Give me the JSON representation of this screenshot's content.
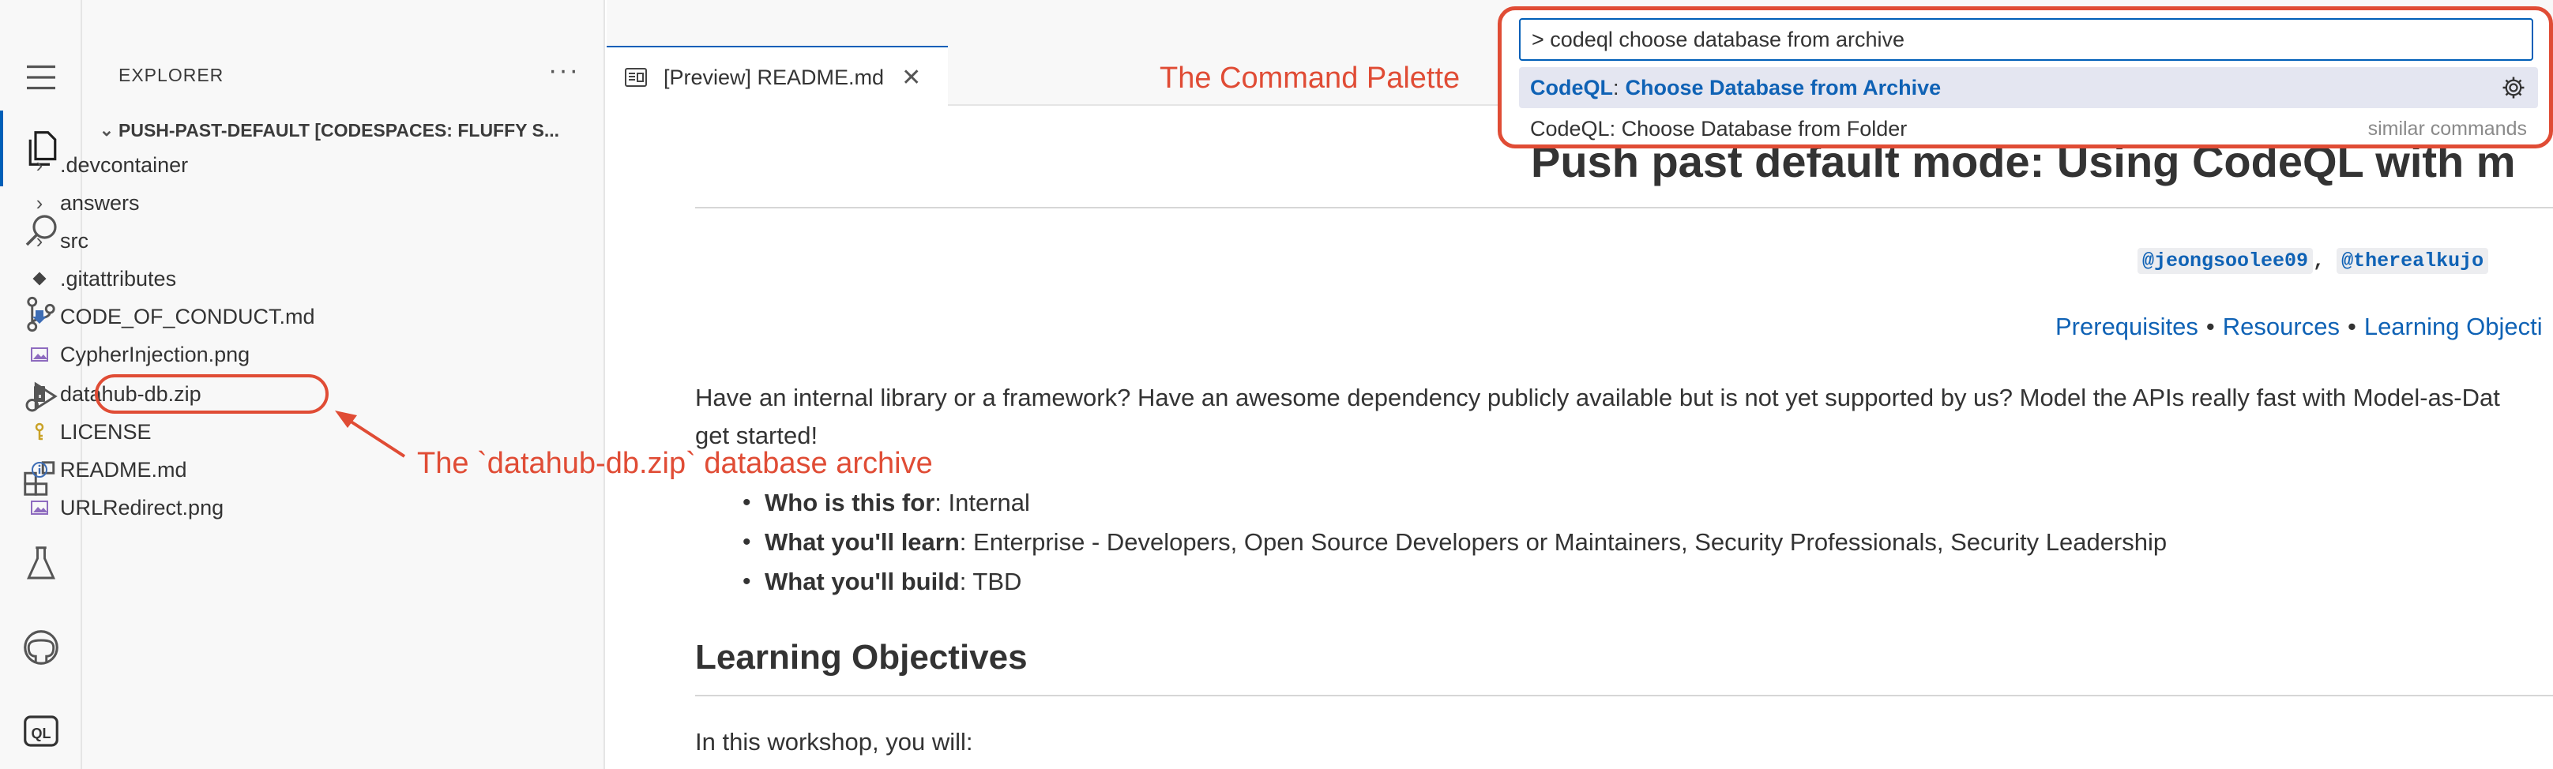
{
  "sidebar": {
    "title": "EXPLORER",
    "more": "···",
    "root_label": "PUSH-PAST-DEFAULT [CODESPACES: FLUFFY S...",
    "items": [
      {
        "label": ".devcontainer",
        "kind": "folder",
        "icon": "chevron-right-icon"
      },
      {
        "label": "answers",
        "kind": "folder",
        "icon": "chevron-right-icon"
      },
      {
        "label": "src",
        "kind": "folder",
        "icon": "chevron-right-icon"
      },
      {
        "label": ".gitattributes",
        "kind": "file",
        "icon": "git-diamond-icon"
      },
      {
        "label": "CODE_OF_CONDUCT.md",
        "kind": "file",
        "icon": "markdown-down-arrow-icon"
      },
      {
        "label": "CypherInjection.png",
        "kind": "file",
        "icon": "image-file-icon"
      },
      {
        "label": "datahub-db.zip",
        "kind": "file",
        "icon": "zip-file-icon"
      },
      {
        "label": "LICENSE",
        "kind": "file",
        "icon": "license-key-icon"
      },
      {
        "label": "README.md",
        "kind": "file",
        "icon": "info-icon"
      },
      {
        "label": "URLRedirect.png",
        "kind": "file",
        "icon": "image-file-icon"
      }
    ]
  },
  "activity_bar": [
    "menu-icon",
    "explorer-icon",
    "search-icon",
    "source-control-icon",
    "run-debug-icon",
    "extensions-icon",
    "testing-icon",
    "github-icon",
    "codeql-icon"
  ],
  "tab": {
    "label": "[Preview] README.md",
    "close": "✕"
  },
  "annotations": {
    "palette_label": "The Command Palette",
    "archive_label": "The `datahub-db.zip` database archive"
  },
  "palette": {
    "input_value": "> codeql choose database from archive",
    "row1_prefix": "CodeQL",
    "row1_colon": ":",
    "row1_text": "Choose Database from Archive",
    "row2_text": "CodeQL: Choose Database from Folder",
    "row2_hint": "similar commands"
  },
  "readme": {
    "h1": "Push past default mode: Using CodeQL with m",
    "author1": "@jeongsoolee09",
    "author_sep": ",",
    "author2": "@therealkujo",
    "links": [
      "Prerequisites",
      "Resources",
      "Learning Objecti"
    ],
    "link_sep": "•",
    "para_line1": "Have an internal library or a framework? Have an awesome dependency publicly available but is not yet supported by us? Model the APIs really fast with Model-as-Dat",
    "para_line2": "get started!",
    "list": [
      {
        "bold": "Who is this for",
        "rest": ": Internal"
      },
      {
        "bold": "What you'll learn",
        "rest": ": Enterprise - Developers, Open Source Developers or Maintainers, Security Professionals, Security Leadership"
      },
      {
        "bold": "What you'll build",
        "rest": ": TBD"
      }
    ],
    "h2": "Learning Objectives",
    "p2": "In this workshop, you will:"
  },
  "colors": {
    "annotation": "#e04c35",
    "link": "#0f62b5",
    "accent": "#005fb8"
  }
}
